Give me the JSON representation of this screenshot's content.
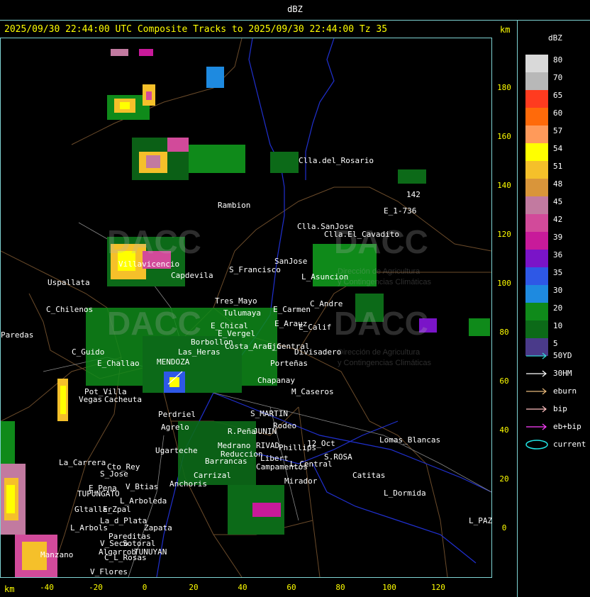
{
  "header": {
    "unit_label": "dBZ"
  },
  "title": {
    "text": "2025/09/30 22:44:00 UTC Composite Tracks to 2025/09/30 22:44:00 Tz 35",
    "km_label": "km"
  },
  "bottom_km_label": "km",
  "y_axis_ticks": [
    "180",
    "160",
    "140",
    "120",
    "100",
    "80",
    "60",
    "40",
    "20",
    "0"
  ],
  "x_axis_ticks": [
    "-40",
    "-20",
    "0",
    "20",
    "40",
    "60",
    "80",
    "100",
    "120"
  ],
  "legend": {
    "title": "dBZ",
    "levels": [
      {
        "label": "80",
        "color": "#d9d9d9"
      },
      {
        "label": "70",
        "color": "#b8b8b8"
      },
      {
        "label": "65",
        "color": "#ff3b1f"
      },
      {
        "label": "60",
        "color": "#ff6a0a"
      },
      {
        "label": "57",
        "color": "#ff9a5a"
      },
      {
        "label": "54",
        "color": "#ffff00"
      },
      {
        "label": "51",
        "color": "#f5c02a"
      },
      {
        "label": "48",
        "color": "#d9953a"
      },
      {
        "label": "45",
        "color": "#c27aa0"
      },
      {
        "label": "42",
        "color": "#d24a9a"
      },
      {
        "label": "39",
        "color": "#c81a9a"
      },
      {
        "label": "36",
        "color": "#7a14c8"
      },
      {
        "label": "35",
        "color": "#2e58e6"
      },
      {
        "label": "30",
        "color": "#1e8ae0"
      },
      {
        "label": "20",
        "color": "#0f8a1a"
      },
      {
        "label": "10",
        "color": "#0c6a18"
      },
      {
        "label": "5",
        "color": "#4a3a8a"
      }
    ],
    "tracks": [
      {
        "label": "50YD",
        "color": "#33d6d6"
      },
      {
        "label": "30HM",
        "color": "#ffffff"
      },
      {
        "label": "eburn",
        "color": "#e6b87a"
      },
      {
        "label": "bip",
        "color": "#ffc0c0"
      },
      {
        "label": "eb+bip",
        "color": "#ff40ff"
      },
      {
        "label": "current",
        "color": "#22e6e6"
      }
    ]
  },
  "watermark": {
    "brand": "DACC",
    "line1": "Dirección de Agricultura",
    "line2": "y Contingencias Climáticas"
  },
  "places": [
    "Clla.del_Rosario",
    "Rambion",
    "Clla.SanJose",
    "Clla.El_Cavadito",
    "E_1-736",
    "142",
    "Uspallata",
    "Villavicencio",
    "Capdevila",
    "S_Francisco",
    "SanJose",
    "L_Asuncion",
    "C_Chilenos",
    "Tres_Mayo",
    "Tulumaya",
    "E_Carmen",
    "C_Andre",
    "Paredas",
    "E_Chical",
    "E_Vergel",
    "E_Arauz",
    "E_Calif",
    "Borbollon",
    "Costa_Araujo",
    "E_Central",
    "Divisadero",
    "Las_Heras",
    "Porteñas",
    "C_Guido",
    "E_Challao",
    "MENDOZA",
    "Chapanay",
    "Pot_Villa",
    "Vegas",
    "Cacheuta",
    "Perdriel",
    "Agrelo",
    "M_Caseros",
    "S_MARTIN",
    "Rodeo",
    "R.Peña",
    "JUNIN",
    "RIVAD",
    "Phillips",
    "Ugarteche",
    "12_Oct",
    "S.ROSA",
    "Lomas_Blancas",
    "La_Carrera",
    "Cto_Rey",
    "S_Jose",
    "Barrancas",
    "Medrano",
    "Reduccion",
    "Libert",
    "L_Central",
    "Campamentos",
    "Catitas",
    "Carrizal",
    "Mirador",
    "E_Pena",
    "TUPUNGATO",
    "V_Btias",
    "Anchoris",
    "L_Arboleda",
    "Gltallar",
    "E_Zpal",
    "L_Dormida",
    "L_Arbols",
    "La_d_Plata",
    "Zapata",
    "L_PAZ",
    "Pareditas",
    "V_Seco",
    "Sotoral",
    "Algarrob",
    "Manzano",
    "C_L_Rosas",
    "TUNUYAN",
    "V_Flores"
  ]
}
